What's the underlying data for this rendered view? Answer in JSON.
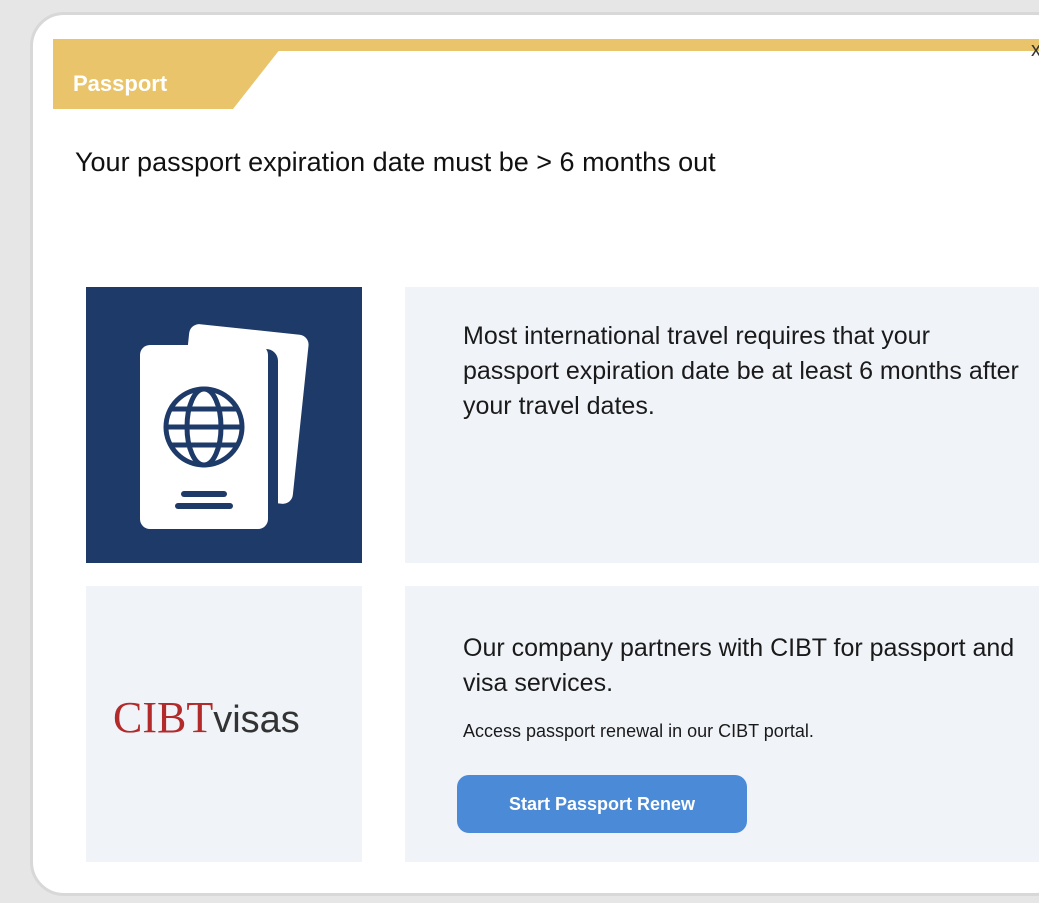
{
  "header": {
    "title": "Passport",
    "close_label": "x"
  },
  "headline": "Your passport expiration date must be > 6 months out",
  "requirement": {
    "icon": "passport-icon",
    "text": "Most international travel requires that your passport expiration date be at least 6 months after your travel dates."
  },
  "partner": {
    "logo_strong": "CIBT",
    "logo_light": "visas",
    "text": "Our company partners with CIBT for passport and visa services.",
    "subtext": "Access passport renewal in our CIBT portal.",
    "button_label": "Start Passport Renew"
  },
  "colors": {
    "accent": "#e9c46a",
    "icon_panel": "#1e3a69",
    "panel_bg": "#f0f4f9",
    "button": "#4a8ad6",
    "logo_red": "#b22a2a"
  }
}
